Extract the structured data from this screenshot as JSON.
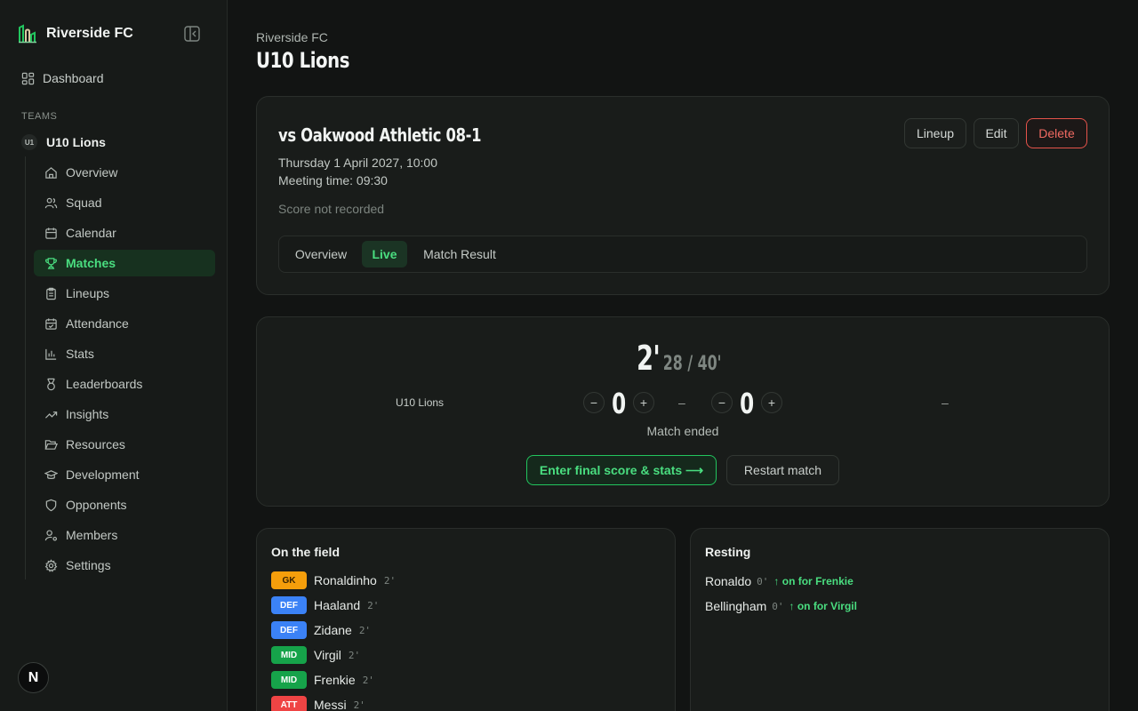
{
  "sidebar": {
    "brand": "Riverside FC",
    "dashboard": "Dashboard",
    "teams_label": "TEAMS",
    "team_badge": "U1",
    "team_name": "U10 Lions",
    "items": [
      {
        "label": "Overview",
        "icon": "home-icon"
      },
      {
        "label": "Squad",
        "icon": "users-icon"
      },
      {
        "label": "Calendar",
        "icon": "calendar-icon"
      },
      {
        "label": "Matches",
        "icon": "trophy-icon",
        "active": true
      },
      {
        "label": "Lineups",
        "icon": "clipboard-icon"
      },
      {
        "label": "Attendance",
        "icon": "calendar-check-icon"
      },
      {
        "label": "Stats",
        "icon": "bar-chart-icon"
      },
      {
        "label": "Leaderboards",
        "icon": "medal-icon"
      },
      {
        "label": "Insights",
        "icon": "trending-up-icon"
      },
      {
        "label": "Resources",
        "icon": "folder-open-icon"
      },
      {
        "label": "Development",
        "icon": "graduation-cap-icon"
      },
      {
        "label": "Opponents",
        "icon": "shield-icon"
      },
      {
        "label": "Members",
        "icon": "user-cog-icon"
      },
      {
        "label": "Settings",
        "icon": "gear-icon"
      }
    ],
    "dev_badge": "N"
  },
  "header": {
    "breadcrumb": "Riverside FC",
    "title": "U10 Lions"
  },
  "match": {
    "title": "vs Oakwood Athletic 08-1",
    "datetime": "Thursday 1 April 2027, 10:00",
    "meeting": "Meeting time: 09:30",
    "score_status": "Score not recorded",
    "buttons": {
      "lineup": "Lineup",
      "edit": "Edit",
      "delete": "Delete"
    },
    "tabs": [
      {
        "label": "Overview"
      },
      {
        "label": "Live",
        "active": true
      },
      {
        "label": "Match Result"
      }
    ]
  },
  "live": {
    "minute": "2'",
    "clock_rest": "28 / 40'",
    "home_team": "U10 Lions",
    "home_score": "0",
    "away_score": "0",
    "separator": "–",
    "away_team": "–",
    "minus": "−",
    "plus": "+",
    "status": "Match ended",
    "final_button": "Enter final score & stats ⟶",
    "restart_button": "Restart match"
  },
  "on_field": {
    "heading": "On the field",
    "players": [
      {
        "pos": "GK",
        "name": "Ronaldinho",
        "minutes": "2'"
      },
      {
        "pos": "DEF",
        "name": "Haaland",
        "minutes": "2'"
      },
      {
        "pos": "DEF",
        "name": "Zidane",
        "minutes": "2'"
      },
      {
        "pos": "MID",
        "name": "Virgil",
        "minutes": "2'"
      },
      {
        "pos": "MID",
        "name": "Frenkie",
        "minutes": "2'"
      },
      {
        "pos": "ATT",
        "name": "Messi",
        "minutes": "2'"
      }
    ]
  },
  "resting": {
    "heading": "Resting",
    "players": [
      {
        "name": "Ronaldo",
        "minutes": "0'",
        "note": "↑ on for Frenkie"
      },
      {
        "name": "Bellingham",
        "minutes": "0'",
        "note": "↑ on for Virgil"
      }
    ]
  },
  "colors": {
    "accent": "#4ade80",
    "danger": "#f06a62",
    "gk": "#f59e0b",
    "def": "#3b82f6",
    "mid": "#16a34a",
    "att": "#ef4444"
  }
}
